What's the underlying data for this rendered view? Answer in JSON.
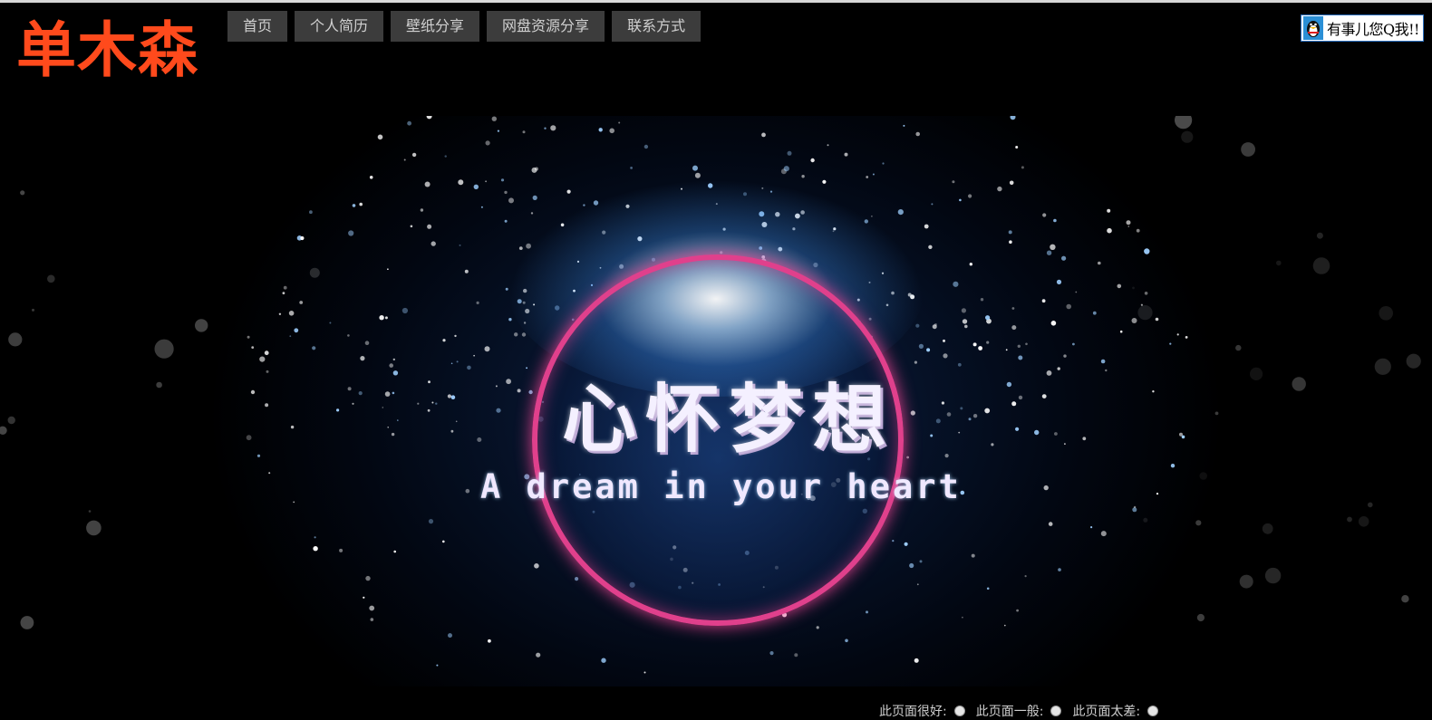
{
  "logo": {
    "text": "单木森",
    "color": "#ff4a1c"
  },
  "nav": {
    "items": [
      {
        "label": "首页"
      },
      {
        "label": "个人简历"
      },
      {
        "label": "壁纸分享"
      },
      {
        "label": "网盘资源分享"
      },
      {
        "label": "联系方式"
      }
    ]
  },
  "qq": {
    "text": "有事儿您Q我!!",
    "icon": "qq-penguin-icon"
  },
  "banner": {
    "title": "心怀梦想",
    "subtitle": "A dream in your heart",
    "ring_color": "#e0408c"
  },
  "rating": {
    "options": [
      {
        "label": "此页面很好:"
      },
      {
        "label": "此页面一般:"
      },
      {
        "label": "此页面太差:"
      }
    ]
  }
}
